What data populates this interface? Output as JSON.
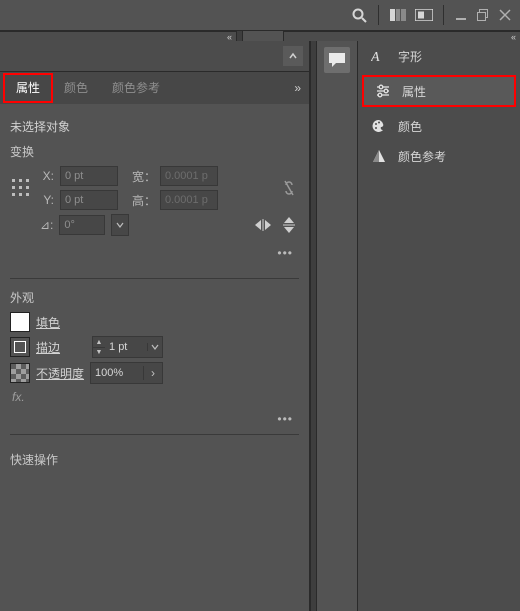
{
  "topbar": {
    "search_icon": "search-icon",
    "arrange_icon": "arrange-icon",
    "screen_icon": "screen-mode-icon",
    "min_icon": "minimize-window-icon",
    "restore_icon": "restore-window-icon",
    "close_icon": "close-window-icon"
  },
  "collapse_glyph": "«",
  "collapse_glyph_r": "«",
  "tabs": {
    "properties": "属性",
    "color": "颜色",
    "color_guide": "颜色参考",
    "more": "»"
  },
  "no_selection": "未选择对象",
  "transform": {
    "title": "变换",
    "x_label": "X:",
    "y_label": "Y:",
    "x_value": "0 pt",
    "y_value": "0 pt",
    "w_label": "宽：",
    "h_label": "高：",
    "w_value": "0.0001 p",
    "h_value": "0.0001 p",
    "angle_label": "⊿:",
    "angle_value": "0°"
  },
  "appearance": {
    "title": "外观",
    "fill": "填色",
    "stroke": "描边",
    "stroke_value": "1 pt",
    "opacity_label": "不透明度",
    "opacity_value": "100%",
    "fx": "fx."
  },
  "quick_actions": "快速操作",
  "menu_dots": "•••",
  "side": {
    "character": "字形",
    "properties": "属性",
    "color": "颜色",
    "color_guide": "颜色参考"
  }
}
